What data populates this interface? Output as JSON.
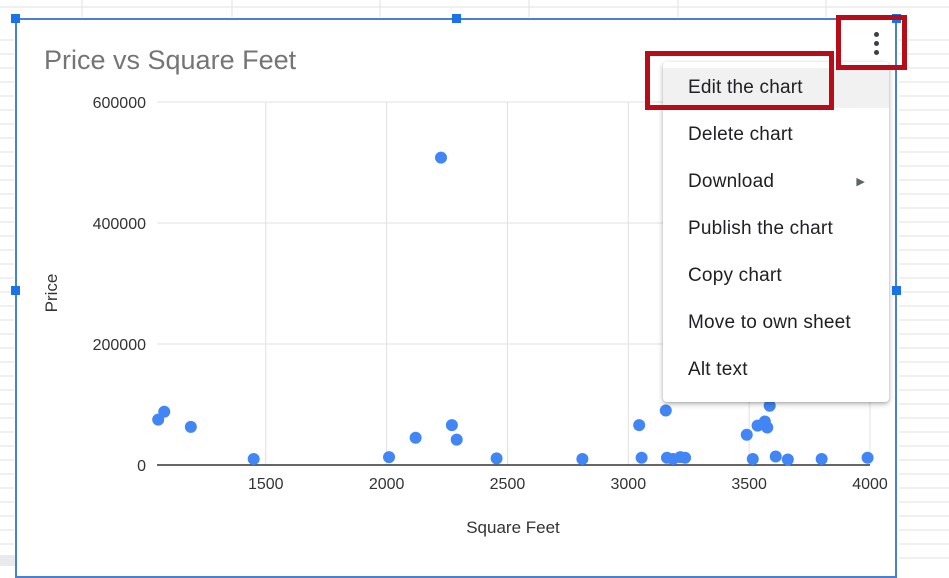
{
  "chart_data": {
    "type": "scatter",
    "title": "Price  vs Square Feet",
    "xlabel": "Square Feet",
    "ylabel": "Price",
    "xlim": [
      1050,
      4000
    ],
    "ylim": [
      0,
      600000
    ],
    "x_ticks": [
      "1500",
      "2000",
      "2500",
      "3000",
      "3500",
      "4000"
    ],
    "y_ticks": [
      "0",
      "200000",
      "400000",
      "600000"
    ],
    "grid": true,
    "legend": "none",
    "point_color": "#4285f4",
    "points": [
      {
        "x": 1055,
        "y": 75000
      },
      {
        "x": 1080,
        "y": 88000
      },
      {
        "x": 1190,
        "y": 63000
      },
      {
        "x": 1450,
        "y": 10000
      },
      {
        "x": 2010,
        "y": 13000
      },
      {
        "x": 2120,
        "y": 45000
      },
      {
        "x": 2225,
        "y": 508000
      },
      {
        "x": 2270,
        "y": 66000
      },
      {
        "x": 2290,
        "y": 42000
      },
      {
        "x": 2455,
        "y": 11000
      },
      {
        "x": 2810,
        "y": 10000
      },
      {
        "x": 3045,
        "y": 66000
      },
      {
        "x": 3055,
        "y": 12000
      },
      {
        "x": 3155,
        "y": 90000
      },
      {
        "x": 3160,
        "y": 12000
      },
      {
        "x": 3185,
        "y": 10000
      },
      {
        "x": 3215,
        "y": 13000
      },
      {
        "x": 3235,
        "y": 12000
      },
      {
        "x": 3490,
        "y": 50000
      },
      {
        "x": 3515,
        "y": 10000
      },
      {
        "x": 3535,
        "y": 65000
      },
      {
        "x": 3565,
        "y": 72000
      },
      {
        "x": 3575,
        "y": 62000
      },
      {
        "x": 3585,
        "y": 98000
      },
      {
        "x": 3610,
        "y": 14000
      },
      {
        "x": 3660,
        "y": 9000
      },
      {
        "x": 3800,
        "y": 10000
      },
      {
        "x": 3990,
        "y": 12000
      }
    ]
  },
  "menu": {
    "items": [
      {
        "label": "Edit the chart"
      },
      {
        "label": "Delete chart"
      },
      {
        "label": "Download",
        "submenu_arrow": "▶"
      },
      {
        "label": "Publish the chart"
      },
      {
        "label": "Copy chart"
      },
      {
        "label": "Move to own sheet"
      },
      {
        "label": "Alt text"
      }
    ]
  },
  "colors": {
    "selection_border": "#4a7fd6",
    "handle": "#1a73e8",
    "highlight": "#b70d18",
    "title": "#757575",
    "axis_text": "#333333"
  },
  "icons": {
    "chart_menu": "more-vert-icon"
  }
}
